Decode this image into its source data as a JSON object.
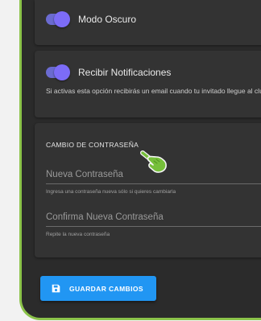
{
  "settings": {
    "dark_mode": {
      "label": "Modo Oscuro",
      "enabled": true
    },
    "notifications": {
      "label": "Recibir Notificaciones",
      "enabled": true,
      "description": "Si activas esta opción recibirás un email cuando tu invitado llegue al club"
    }
  },
  "password": {
    "title": "CAMBIO DE CONTRASEÑA",
    "new_password": {
      "placeholder": "Nueva Contraseña",
      "hint": "Ingresa una contraseña nueva sólo si quieres cambiarla"
    },
    "confirm_password": {
      "placeholder": "Confirma Nueva Contraseña",
      "hint": "Repite la nueva contraseña"
    }
  },
  "actions": {
    "save_label": "GUARDAR CAMBIOS",
    "save_icon": "save-icon"
  },
  "pointer": {
    "icon": "hand-pointer-icon"
  },
  "colors": {
    "accent_toggle": "#7c6cf7",
    "button": "#2196f3",
    "frame_border": "#8bc34a",
    "card": "#333333",
    "background": "#2b2b2b"
  }
}
